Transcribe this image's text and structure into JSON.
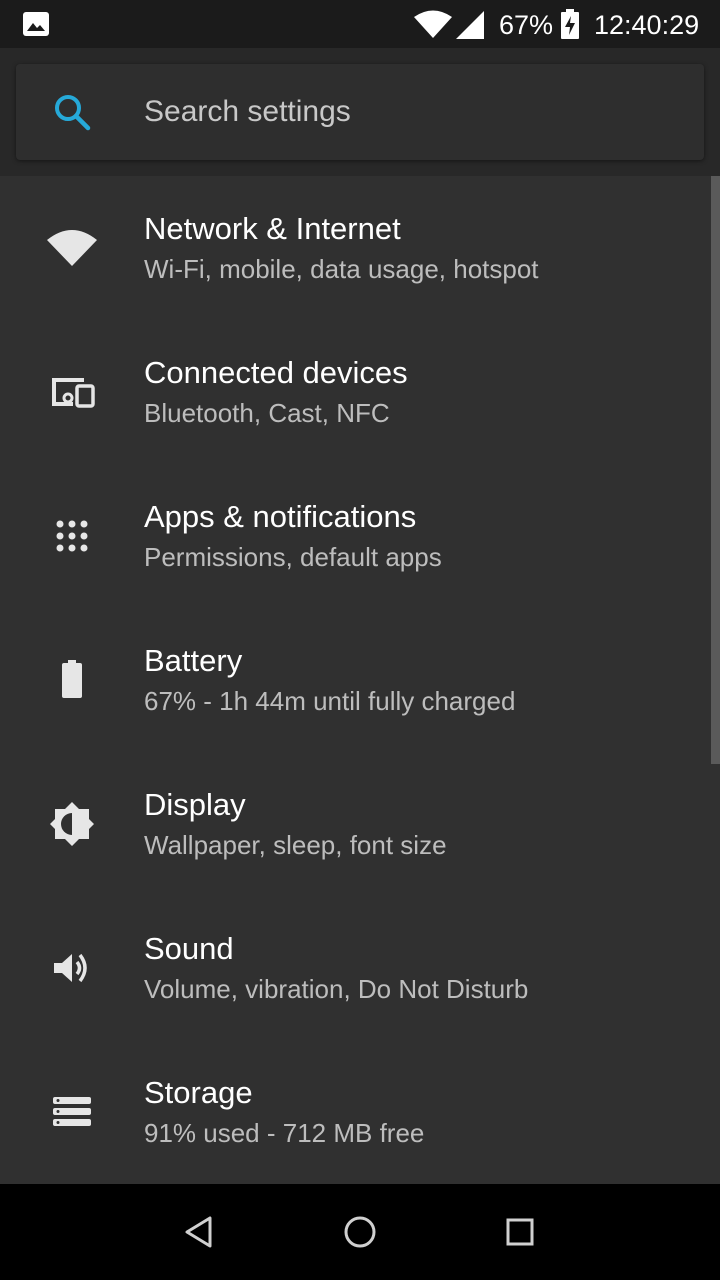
{
  "status_bar": {
    "battery_percent": "67%",
    "time": "12:40:29",
    "icons": [
      "image-notification-icon",
      "wifi-icon",
      "cell-signal-icon",
      "battery-charging-icon"
    ]
  },
  "search": {
    "placeholder": "Search settings",
    "icon": "search-icon"
  },
  "settings": {
    "items": [
      {
        "title": "Network & Internet",
        "summary": "Wi-Fi, mobile, data usage, hotspot",
        "icon": "wifi-icon"
      },
      {
        "title": "Connected devices",
        "summary": "Bluetooth, Cast, NFC",
        "icon": "devices-icon"
      },
      {
        "title": "Apps & notifications",
        "summary": "Permissions, default apps",
        "icon": "apps-grid-icon"
      },
      {
        "title": "Battery",
        "summary": "67% - 1h 44m until fully charged",
        "icon": "battery-icon"
      },
      {
        "title": "Display",
        "summary": "Wallpaper, sleep, font size",
        "icon": "brightness-icon"
      },
      {
        "title": "Sound",
        "summary": "Volume, vibration, Do Not Disturb",
        "icon": "volume-icon"
      },
      {
        "title": "Storage",
        "summary": "91% used - 712 MB free",
        "icon": "storage-icon"
      }
    ]
  },
  "nav_bar": {
    "icons": [
      "back-icon",
      "home-icon",
      "recents-icon"
    ]
  },
  "colors": {
    "background": "#303030",
    "status_bar": "#1b1b1b",
    "accent": "#26a9d8",
    "title_text": "#ffffff",
    "summary_text": "#bdbdbd"
  }
}
